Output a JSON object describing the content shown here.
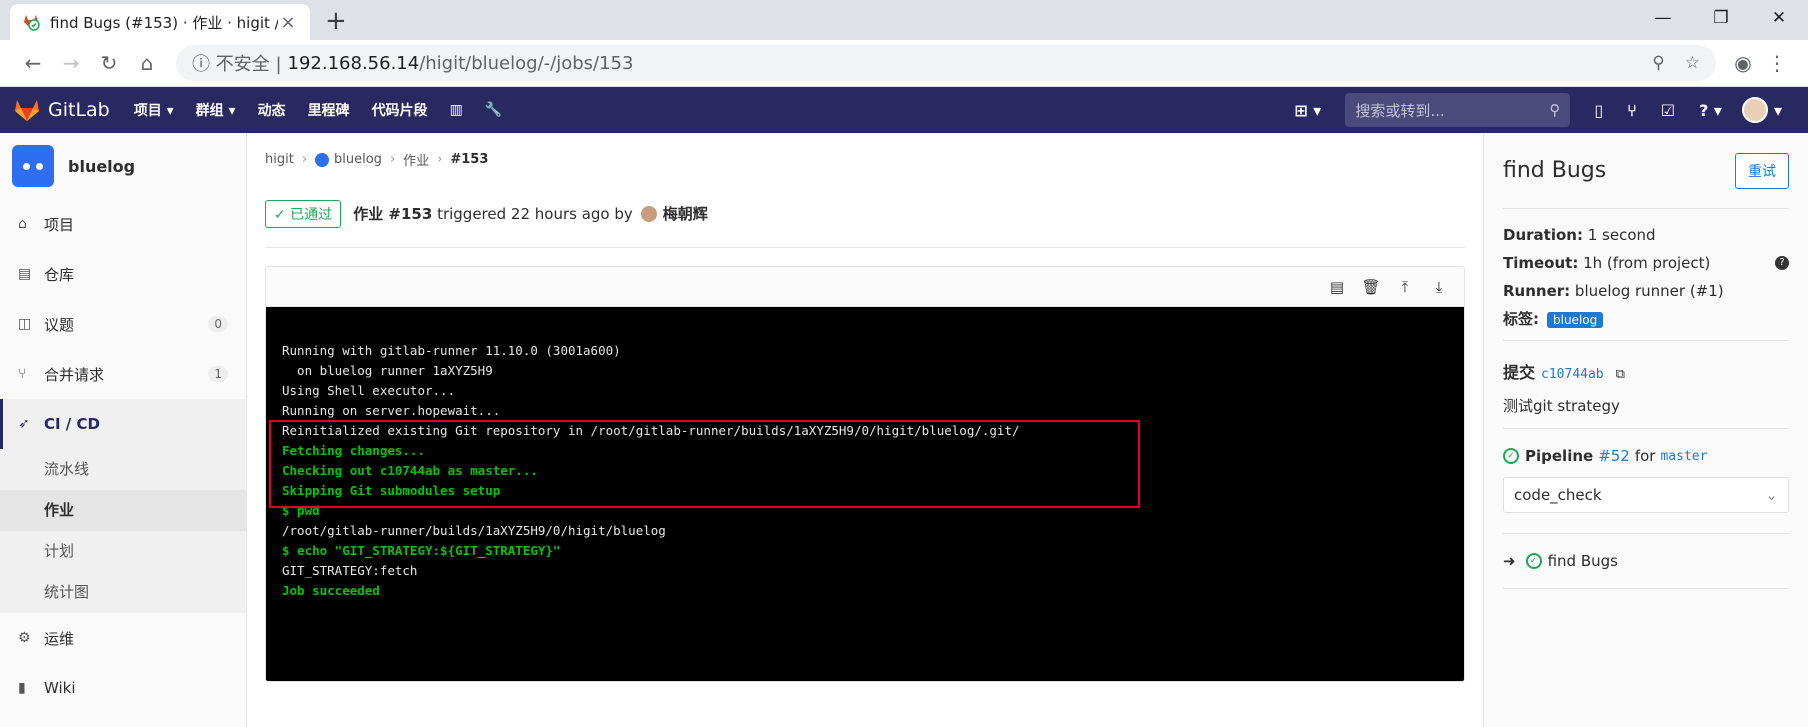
{
  "browser": {
    "tab_title": "find Bugs (#153) · 作业 · higit /",
    "tab_close": "×",
    "new_tab": "+",
    "win_min": "—",
    "win_max": "❐",
    "win_close": "✕",
    "security": "ⓘ 不安全 |",
    "host": "192.168.56.14",
    "path": "/higit/bluelog/-/jobs/153"
  },
  "gitlab": {
    "brand": "GitLab",
    "nav": [
      "项目 ▾",
      "群组 ▾",
      "动态",
      "里程碑",
      "代码片段"
    ],
    "search_placeholder": "搜索或转到..."
  },
  "sidebar": {
    "project": "bluelog",
    "items": [
      {
        "label": "项目",
        "count": ""
      },
      {
        "label": "仓库",
        "count": ""
      },
      {
        "label": "议题",
        "count": "0"
      },
      {
        "label": "合并请求",
        "count": "1"
      },
      {
        "label": "CI / CD",
        "count": ""
      }
    ],
    "cicd_sub": [
      "流水线",
      "作业",
      "计划",
      "统计图"
    ],
    "bottom": [
      "运维",
      "Wiki"
    ]
  },
  "breadcrumb": {
    "a": "higit",
    "b": "bluelog",
    "c": "作业",
    "d": "#153"
  },
  "job": {
    "status": "✓ 已通过",
    "title": "作业 #153",
    "triggered": " triggered 22 hours ago by",
    "user": "梅朝辉"
  },
  "log": [
    {
      "t": "Running with gitlab-runner 11.10.0 (3001a600)",
      "c": "w"
    },
    {
      "t": "  on bluelog runner 1aXYZ5H9",
      "c": "w"
    },
    {
      "t": "Using Shell executor...",
      "c": "w"
    },
    {
      "t": "Running on server.hopewait...",
      "c": "w"
    },
    {
      "t": "Reinitialized existing Git repository in /root/gitlab-runner/builds/1aXYZ5H9/0/higit/bluelog/.git/",
      "c": "w"
    },
    {
      "t": "Fetching changes...",
      "c": "g"
    },
    {
      "t": "Checking out c10744ab as master...",
      "c": "g"
    },
    {
      "t": "Skipping Git submodules setup",
      "c": "g"
    },
    {
      "t": "$ pwd",
      "c": "g"
    },
    {
      "t": "/root/gitlab-runner/builds/1aXYZ5H9/0/higit/bluelog",
      "c": "w"
    },
    {
      "t": "$ echo \"GIT_STRATEGY:${GIT_STRATEGY}\"",
      "c": "g"
    },
    {
      "t": "GIT_STRATEGY:fetch",
      "c": "w"
    },
    {
      "t": "Job succeeded",
      "c": "g"
    }
  ],
  "panel": {
    "title": "find Bugs",
    "retry": "重试",
    "duration_label": "Duration:",
    "duration": " 1 second",
    "timeout_label": "Timeout:",
    "timeout": " 1h (from project)",
    "runner_label": "Runner:",
    "runner": " bluelog runner (#1)",
    "tags_label": "标签:",
    "tag": "bluelog",
    "commit_label": "提交",
    "commit_sha": "c10744ab",
    "commit_msg": "测试git strategy",
    "pipeline_label": "Pipeline",
    "pipeline_num": "#52",
    "pipeline_for": "for",
    "pipeline_branch": "master",
    "stage": "code_check",
    "job_name": "find Bugs"
  },
  "colors": {
    "header": "#292961",
    "success": "#1aaa55",
    "link": "#1f78d1",
    "highlight": "#e4001b"
  }
}
